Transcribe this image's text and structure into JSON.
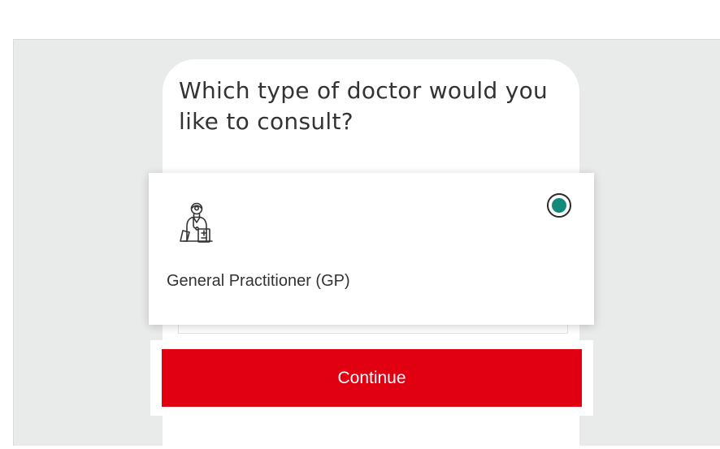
{
  "question": {
    "title": "Which type of doctor would you like to consult?"
  },
  "options": [
    {
      "label": "General Practitioner (GP)",
      "icon": "doctor-icon",
      "selected": true
    }
  ],
  "actions": {
    "continue_label": "Continue"
  },
  "colors": {
    "accent": "#e10012",
    "radio_selected": "#128a7a",
    "background": "#e9eaea"
  }
}
